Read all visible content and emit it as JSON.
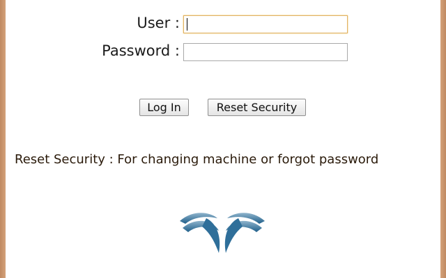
{
  "login": {
    "user_label": "User :",
    "password_label": "Password :",
    "user_value": "",
    "password_value": ""
  },
  "buttons": {
    "login_label": "Log In",
    "reset_label": "Reset Security"
  },
  "note": {
    "text": "Reset Security : For changing machine or forgot password"
  },
  "logo": {
    "icon": "stylized-blue-wings-logo-icon"
  },
  "colors": {
    "frame_border": "#c08a62",
    "focus_border": "#e0b060",
    "logo_blue": "#2f6f9a"
  }
}
